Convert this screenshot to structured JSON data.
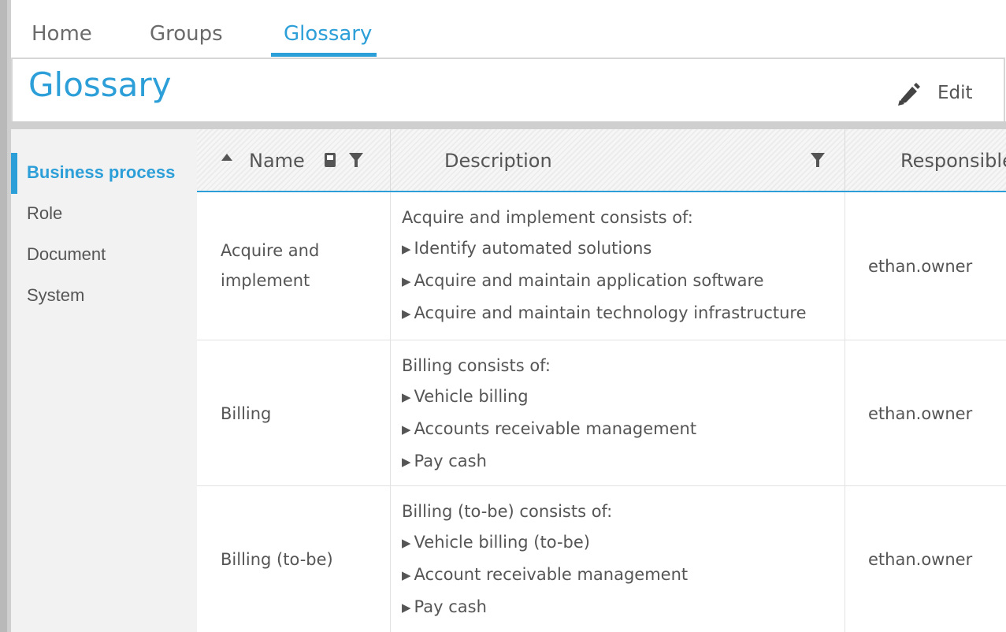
{
  "tabs": [
    {
      "label": "Home",
      "active": false
    },
    {
      "label": "Groups",
      "active": false
    },
    {
      "label": "Glossary",
      "active": true
    }
  ],
  "header": {
    "title": "Glossary",
    "edit_label": "Edit"
  },
  "sidebar": {
    "items": [
      {
        "label": "Business process",
        "active": true
      },
      {
        "label": "Role",
        "active": false
      },
      {
        "label": "Document",
        "active": false
      },
      {
        "label": "System",
        "active": false
      }
    ]
  },
  "table": {
    "columns": [
      {
        "label": "Name",
        "sort": "ascending",
        "icons": [
          "sort-up-icon",
          "book-icon",
          "filter-icon"
        ]
      },
      {
        "label": "Description",
        "icons": [
          "filter-icon"
        ]
      },
      {
        "label": "Responsible"
      }
    ],
    "rows": [
      {
        "name": "Acquire and implement",
        "name_lines": [
          "Acquire and",
          "implement"
        ],
        "desc_intro": "Acquire and implement consists of:",
        "desc_items": [
          "Identify automated solutions",
          "Acquire and maintain application software",
          "Acquire and maintain technology infrastructure"
        ],
        "responsible": "ethan.owner"
      },
      {
        "name": "Billing",
        "name_lines": [
          "Billing"
        ],
        "desc_intro": "Billing consists of:",
        "desc_items": [
          "Vehicle billing",
          "Accounts receivable management",
          "Pay cash"
        ],
        "responsible": "ethan.owner"
      },
      {
        "name": "Billing (to-be)",
        "name_lines": [
          "Billing (to-be)"
        ],
        "desc_intro": "Billing (to-be) consists of:",
        "desc_items": [
          "Vehicle billing (to-be)",
          "Account receivable management",
          "Pay cash"
        ],
        "responsible": "ethan.owner"
      }
    ]
  },
  "colors": {
    "accent": "#2d9fd8",
    "sidebar_bg": "#f2f2f2",
    "text": "#555555"
  }
}
